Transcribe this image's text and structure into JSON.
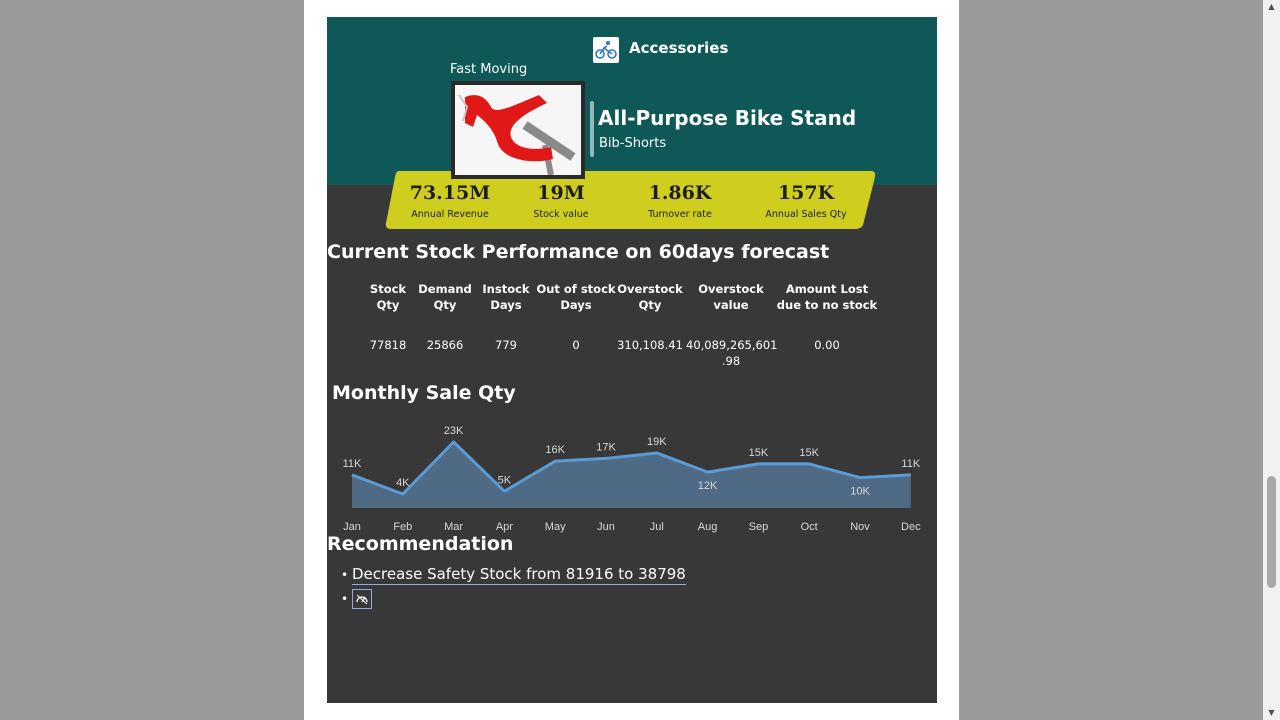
{
  "header": {
    "category": "Accessories",
    "category_icon": "cyclist-icon",
    "badge": "Fast Moving",
    "product_name": "All-Purpose Bike Stand",
    "product_subcategory": "Bib-Shorts",
    "band_color": "#cfcd1d",
    "header_color": "#0e5858"
  },
  "kpis": [
    {
      "value": "73.15M",
      "label": "Annual Revenue"
    },
    {
      "value": "19M",
      "label": "Stock value"
    },
    {
      "value": "1.86K",
      "label": "Turnover rate"
    },
    {
      "value": "157K",
      "label": "Annual Sales Qty"
    }
  ],
  "stock_section": {
    "title": "Current Stock Performance on 60days forecast",
    "columns": [
      [
        "Stock",
        "Qty"
      ],
      [
        "Demand",
        "Qty"
      ],
      [
        "Instock",
        "Days"
      ],
      [
        "Out of stock",
        "Days"
      ],
      [
        "Overstock",
        "Qty"
      ],
      [
        "Overstock",
        "value"
      ],
      [
        "Amount Lost",
        "due to no stock"
      ]
    ],
    "values": [
      [
        "77818"
      ],
      [
        "25866"
      ],
      [
        "779"
      ],
      [
        "0"
      ],
      [
        "310,108.41"
      ],
      [
        "40,089,265,601",
        ".98"
      ],
      [
        "0.00"
      ]
    ]
  },
  "chart_title": "Monthly Sale Qty",
  "chart_data": {
    "type": "area",
    "categories": [
      "Jan",
      "Feb",
      "Mar",
      "Apr",
      "May",
      "Jun",
      "Jul",
      "Aug",
      "Sep",
      "Oct",
      "Nov",
      "Dec"
    ],
    "values": [
      11,
      4,
      23,
      5,
      16,
      17,
      19,
      12,
      15,
      15,
      10,
      11
    ],
    "data_labels": [
      "11K",
      "4K",
      "23K",
      "5K",
      "16K",
      "17K",
      "19K",
      "12K",
      "15K",
      "15K",
      "10K",
      "11K"
    ],
    "unit": "K",
    "line_color": "#5b9bd5",
    "fill_color": "#4e6a85",
    "grid": false
  },
  "recommendation": {
    "title": "Recommendation",
    "items": [
      "Decrease Safety Stock from 81916 to 38798"
    ],
    "icon_item": "speedometer-icon"
  }
}
